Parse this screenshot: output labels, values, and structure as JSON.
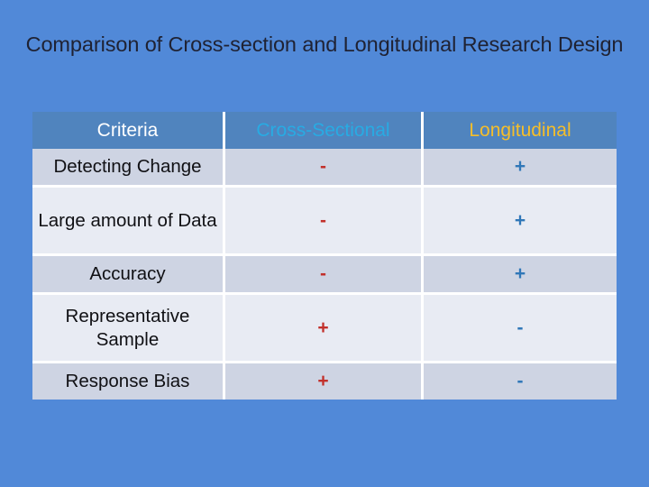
{
  "slide": {
    "title": "Comparison of Cross-section and Longitudinal Research Design",
    "background_color": "#5189d8"
  },
  "table": {
    "header_background": "#5084be",
    "row_dark_background": "#ced4e3",
    "row_light_background": "#e8ebf3",
    "columns": [
      {
        "key": "criteria",
        "label": "Criteria",
        "color": "#ffffff"
      },
      {
        "key": "cross",
        "label": "Cross-Sectional",
        "color": "#28abe3"
      },
      {
        "key": "longitudinal",
        "label": "Longitudinal",
        "color": "#f5be2a"
      }
    ],
    "mark_colors": {
      "cross": "#c2302b",
      "longitudinal": "#3077b8"
    },
    "rows": [
      {
        "criteria": "Detecting Change",
        "cross": "-",
        "longitudinal": "+",
        "shade": "dark",
        "lines": 1
      },
      {
        "criteria": "Large amount of Data",
        "cross": "-",
        "longitudinal": "+",
        "shade": "light",
        "lines": 2
      },
      {
        "criteria": "Accuracy",
        "cross": "-",
        "longitudinal": "+",
        "shade": "dark",
        "lines": 1
      },
      {
        "criteria": "Representative Sample",
        "cross": "+",
        "longitudinal": "-",
        "shade": "light",
        "lines": 2
      },
      {
        "criteria": "Response Bias",
        "cross": "+",
        "longitudinal": "-",
        "shade": "dark",
        "lines": 1
      }
    ]
  }
}
